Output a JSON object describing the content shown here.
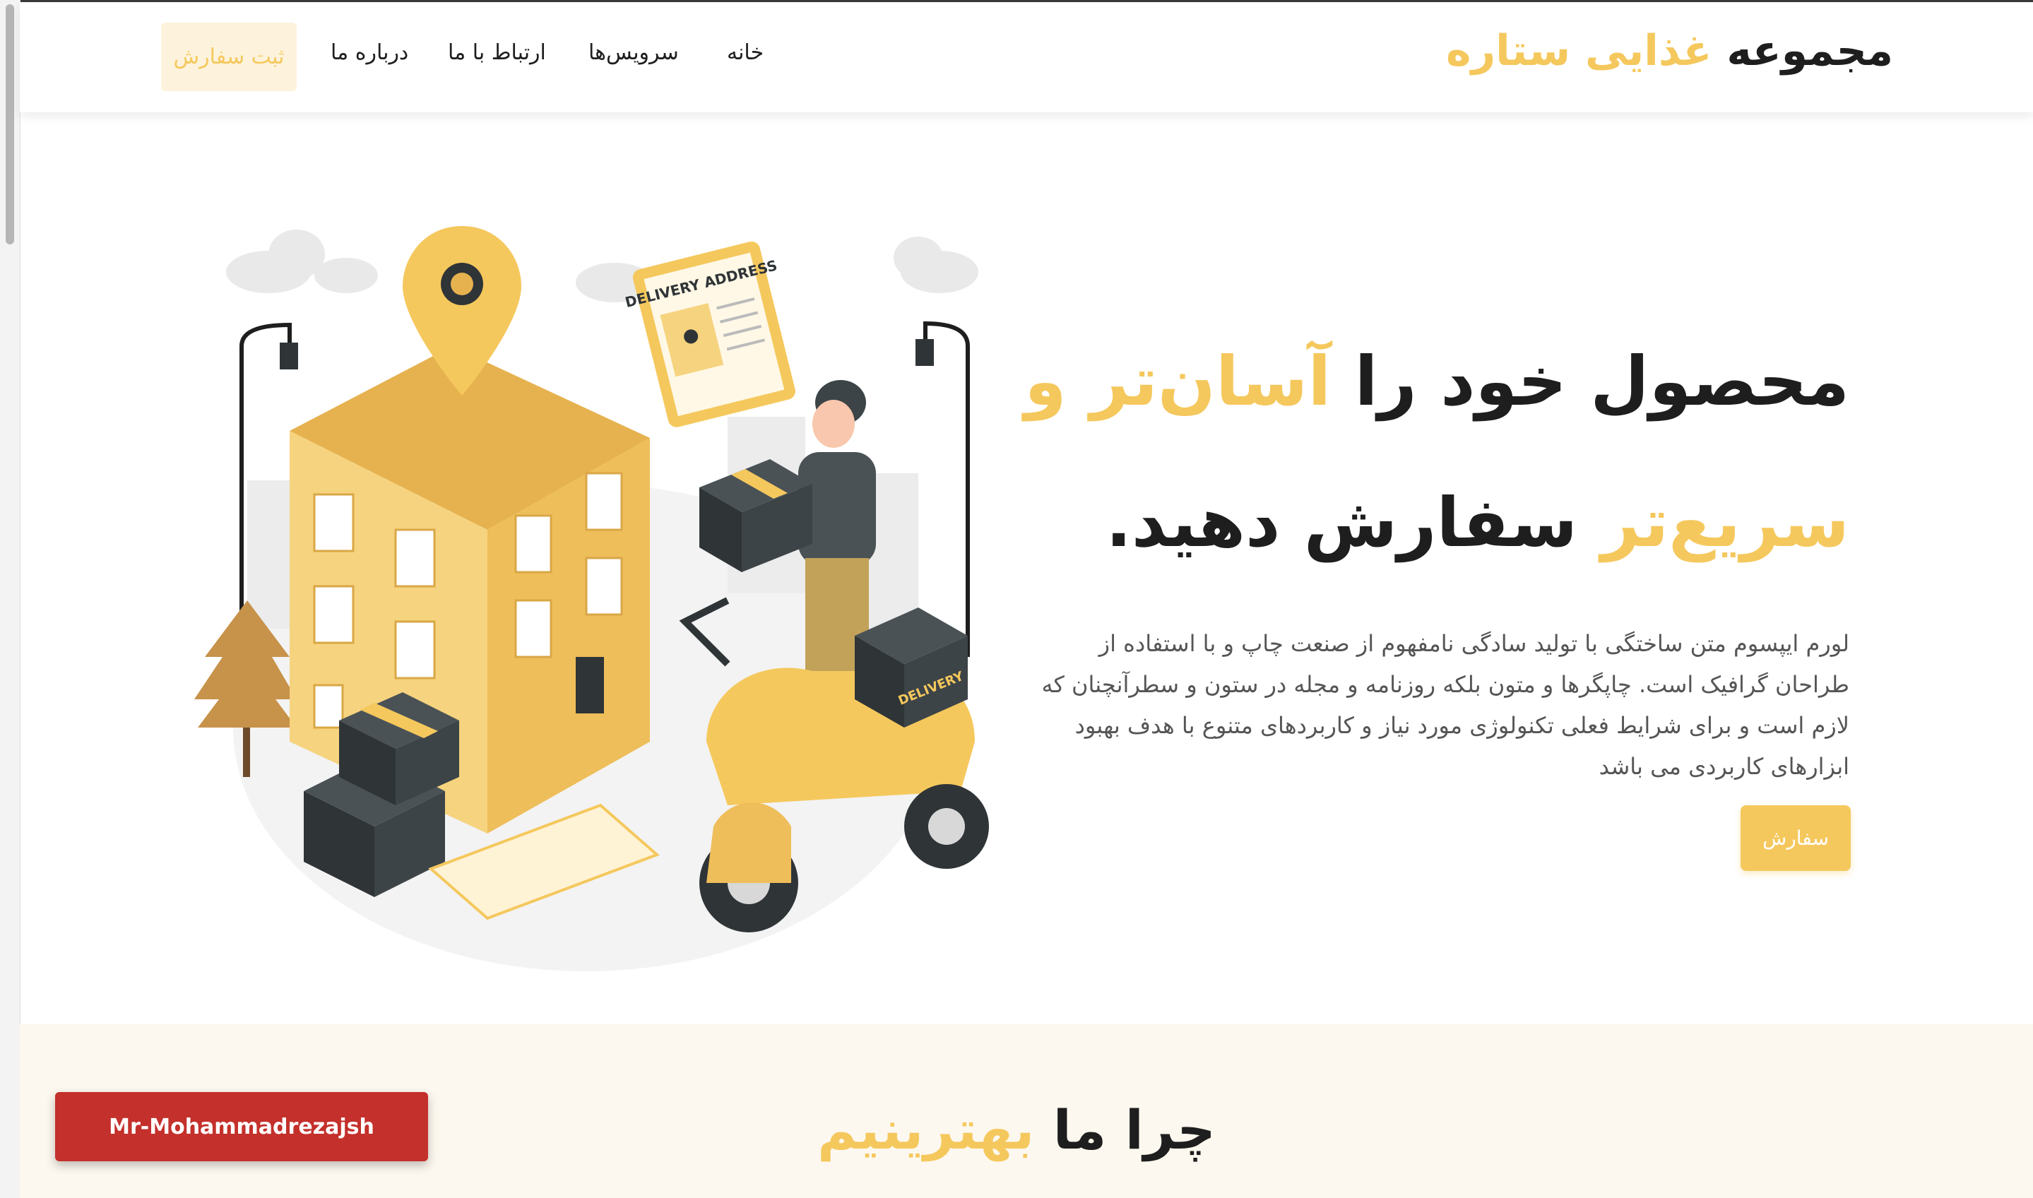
{
  "header": {
    "brand_main": "مجموعه",
    "brand_highlight": "غذایی ستاره",
    "nav": [
      "خانه",
      "سرویس‌ها",
      "ارتباط با ما",
      "درباره ما"
    ],
    "order_button": "ثبت سفارش"
  },
  "hero": {
    "title_part1": "محصول خود را",
    "title_highlight1": "آسان‌تر و",
    "title_highlight2": "سریع‌تر",
    "title_part2": "سفارش دهید.",
    "description": "لورم ایپسوم متن ساختگی با تولید سادگی نامفهوم از صنعت چاپ و با استفاده از طراحان گرافیک است. چاپگرها و متون بلکه روزنامه و مجله در ستون و سطرآنچنان که لازم است و برای شرایط فعلی تکنولوژی مورد نیاز و کاربردهای متنوع با هدف بهبود ابزارهای کاربردی می باشد",
    "button": "سفارش"
  },
  "illustration": {
    "sign_text": "DELIVERY ADDRESS",
    "box_label": "DELIVERY"
  },
  "why": {
    "part1": "چرا ما",
    "highlight": "بهترینیم"
  },
  "credit": "Mr-Mohammadrezajsh",
  "colors": {
    "accent": "#f5c85d",
    "accent_light": "#fdf3dc",
    "dark": "#1e1e1e",
    "credit_red": "#c4302b",
    "section_bg": "#fdf8ef"
  }
}
